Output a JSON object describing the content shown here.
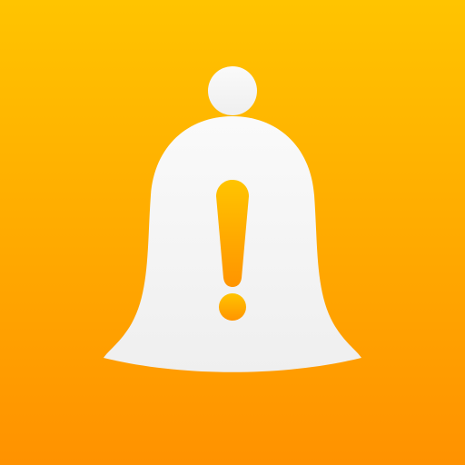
{
  "icon": {
    "name": "bell-alert-icon",
    "colors": {
      "background_top": "#FFC400",
      "background_bottom": "#FF9200",
      "bell_fill": "#F4F4F4",
      "exclamation_top": "#FFC400",
      "exclamation_bottom": "#FF9400"
    }
  }
}
